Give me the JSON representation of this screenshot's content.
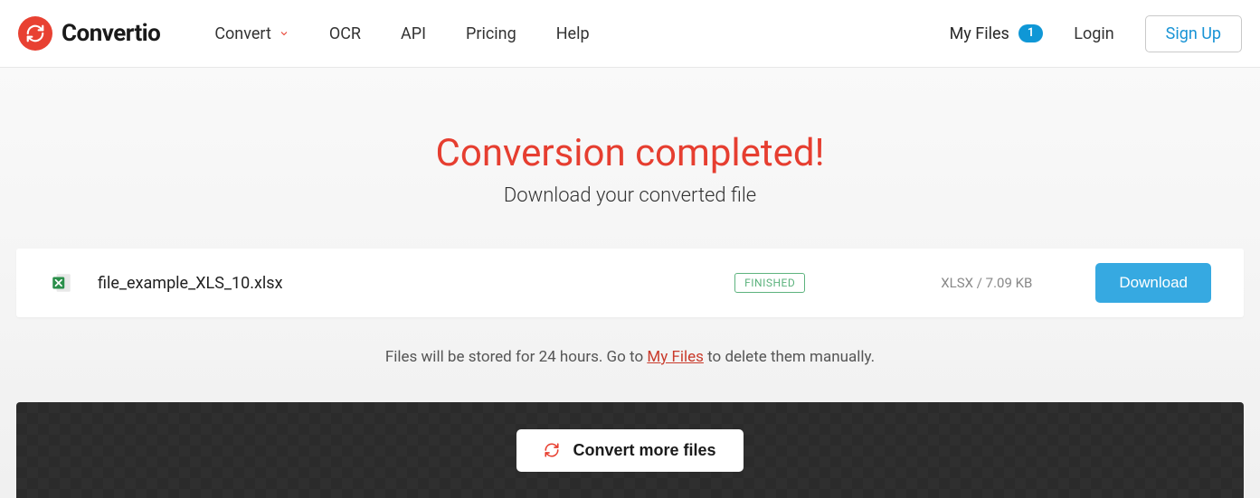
{
  "brand": {
    "name": "Convertio"
  },
  "nav": {
    "convert": "Convert",
    "ocr": "OCR",
    "api": "API",
    "pricing": "Pricing",
    "help": "Help"
  },
  "right": {
    "myfiles_label": "My Files",
    "myfiles_count": "1",
    "login": "Login",
    "signup": "Sign Up"
  },
  "hero": {
    "title": "Conversion completed!",
    "subtitle": "Download your converted file"
  },
  "file": {
    "name": "file_example_XLS_10.xlsx",
    "status": "FINISHED",
    "meta": "XLSX / 7.09 KB",
    "download_label": "Download"
  },
  "note": {
    "prefix": "Files will be stored for 24 hours. Go to ",
    "link": "My Files",
    "suffix": " to delete them manually."
  },
  "footer": {
    "convert_more": "Convert more files"
  }
}
